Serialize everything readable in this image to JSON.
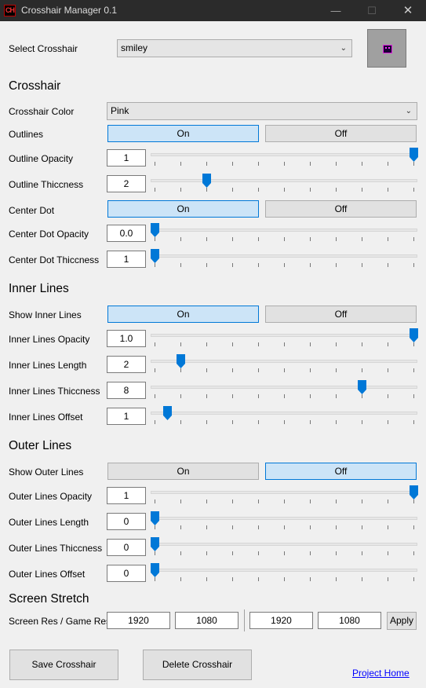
{
  "window": {
    "title": "Crosshair Manager 0.1",
    "icon": "app-logo-icon",
    "icon_text": "CH",
    "controls": [
      "minimize-icon",
      "maximize-icon",
      "close-icon"
    ],
    "minimize": "—",
    "maximize": "☐",
    "close": "✕"
  },
  "select": {
    "label": "Select Crosshair",
    "value": "smiley"
  },
  "sections": {
    "crosshair": "Crosshair",
    "inner": "Inner Lines",
    "outer": "Outer Lines",
    "stretch": "Screen Stretch"
  },
  "colors": {
    "accent": "#0078d7",
    "active_bg": "#cce4f7",
    "preview_bg": "#a0a0a0",
    "crosshair_pink": "#ff33ff"
  },
  "crosshair": {
    "color_label": "Crosshair Color",
    "color_value": "Pink",
    "outlines": {
      "label": "Outlines",
      "on": "On",
      "off": "Off",
      "state": "on"
    },
    "outline_opacity": {
      "label": "Outline Opacity",
      "value": "1",
      "slider": 1.0
    },
    "outline_thiccness": {
      "label": "Outline Thiccness",
      "value": "2",
      "slider": 0.2
    },
    "center_dot": {
      "label": "Center Dot",
      "on": "On",
      "off": "Off",
      "state": "on"
    },
    "center_dot_opacity": {
      "label": "Center Dot Opacity",
      "value": "0.0",
      "slider": 0.0
    },
    "center_dot_thiccness": {
      "label": "Center Dot Thiccness",
      "value": "1",
      "slider": 0.0
    }
  },
  "inner": {
    "show": {
      "label": "Show Inner Lines",
      "on": "On",
      "off": "Off",
      "state": "on"
    },
    "opacity": {
      "label": "Inner Lines Opacity",
      "value": "1.0",
      "slider": 1.0
    },
    "length": {
      "label": "Inner Lines Length",
      "value": "2",
      "slider": 0.1
    },
    "thiccness": {
      "label": "Inner Lines Thiccness",
      "value": "8",
      "slider": 0.8
    },
    "offset": {
      "label": "Inner Lines Offset",
      "value": "1",
      "slider": 0.05
    }
  },
  "outer": {
    "show": {
      "label": "Show Outer Lines",
      "on": "On",
      "off": "Off",
      "state": "off"
    },
    "opacity": {
      "label": "Outer Lines Opacity",
      "value": "1",
      "slider": 1.0
    },
    "length": {
      "label": "Outer Lines Length",
      "value": "0",
      "slider": 0.0
    },
    "thiccness": {
      "label": "Outer Lines Thiccness",
      "value": "0",
      "slider": 0.0
    },
    "offset": {
      "label": "Outer Lines Offset",
      "value": "0",
      "slider": 0.0
    }
  },
  "stretch": {
    "label": "Screen Res / Game Res",
    "screen_w": "1920",
    "screen_h": "1080",
    "game_w": "1920",
    "game_h": "1080",
    "apply": "Apply"
  },
  "footer": {
    "save": "Save Crosshair",
    "delete": "Delete Crosshair",
    "link": "Project Home"
  },
  "icons": {
    "dropdown": "chevron-down-icon",
    "slider_thumb": "slider-thumb-icon"
  },
  "chevron": "⌄"
}
